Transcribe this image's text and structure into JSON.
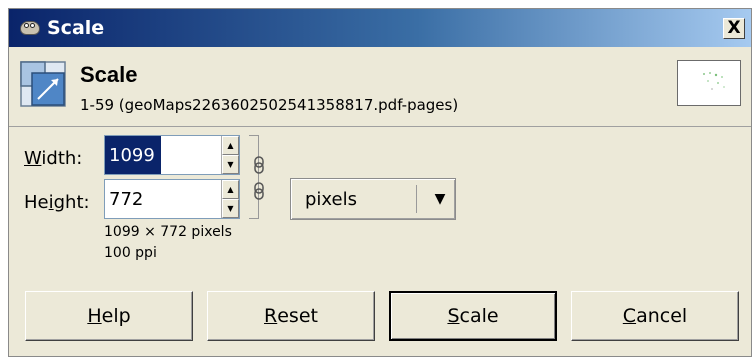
{
  "window": {
    "title": "Scale",
    "close_label": "X"
  },
  "header": {
    "title": "Scale",
    "subtitle": "1-59 (geoMaps2263602502541358817.pdf-pages)"
  },
  "form": {
    "width_label_mnemonic": "W",
    "width_label_rest": "idth:",
    "width_value": "1099",
    "height_label_pre": "He",
    "height_label_mnemonic": "i",
    "height_label_rest": "ght:",
    "height_value": "772",
    "unit": "pixels",
    "size_info": "1099 × 772 pixels",
    "resolution_info": "100 ppi"
  },
  "buttons": {
    "help_mnemonic": "H",
    "help_rest": "elp",
    "reset_mnemonic": "R",
    "reset_rest": "eset",
    "scale_mnemonic": "S",
    "scale_rest": "cale",
    "cancel_mnemonic": "C",
    "cancel_rest": "ancel"
  },
  "icons": {
    "app": "gimp-icon",
    "header": "scale-image-icon",
    "chain": "chain-link-icon",
    "dropdown": "triangle-down-icon"
  }
}
